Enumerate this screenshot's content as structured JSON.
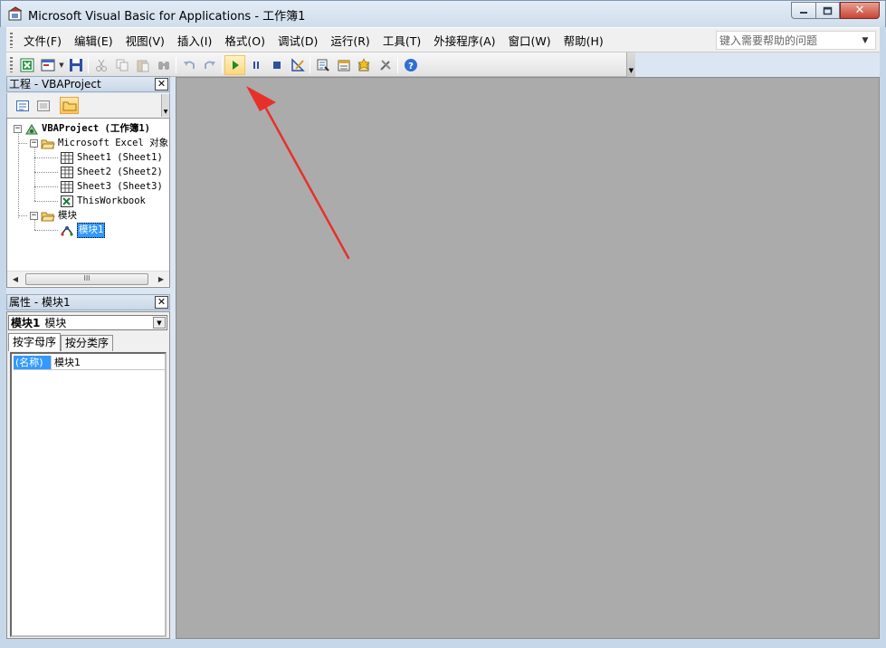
{
  "window": {
    "title": "Microsoft Visual Basic for Applications - 工作簿1",
    "minimize_glyph": "▭",
    "restore_glyph": "⧉",
    "close_glyph": "✕"
  },
  "menu": {
    "items": [
      "文件(F)",
      "编辑(E)",
      "视图(V)",
      "插入(I)",
      "格式(O)",
      "调试(D)",
      "运行(R)",
      "工具(T)",
      "外接程序(A)",
      "窗口(W)",
      "帮助(H)"
    ],
    "help_placeholder": "键入需要帮助的问题"
  },
  "toolbar": {
    "buttons": [
      "view-excel-icon",
      "insert-userform-icon",
      "save-icon",
      "cut-icon",
      "copy-icon",
      "paste-icon",
      "find-icon",
      "undo-icon",
      "redo-icon",
      "run-icon",
      "break-icon",
      "reset-icon",
      "design-mode-icon",
      "project-explorer-icon",
      "properties-window-icon",
      "object-browser-icon",
      "toolbox-icon",
      "help-icon"
    ],
    "active_button": "run-icon"
  },
  "project_pane": {
    "title": "工程 - VBAProject",
    "tree": {
      "root": "VBAProject (工作簿1)",
      "excel_objects_folder": "Microsoft Excel 对象",
      "sheets": [
        "Sheet1 (Sheet1)",
        "Sheet2 (Sheet2)",
        "Sheet3 (Sheet3)"
      ],
      "workbook": "ThisWorkbook",
      "modules_folder": "模块",
      "module": "模块1"
    },
    "scroll_thumb": "III"
  },
  "properties_pane": {
    "title": "属性 - 模块1",
    "object_name": "模块1",
    "object_type": "模块",
    "tabs": [
      "按字母序",
      "按分类序"
    ],
    "rows": [
      {
        "name": "(名称)",
        "value": "模块1"
      }
    ]
  },
  "colors": {
    "workspace": "#ababab",
    "selection": "#3399ff",
    "annotation_arrow": "#e8302a"
  }
}
